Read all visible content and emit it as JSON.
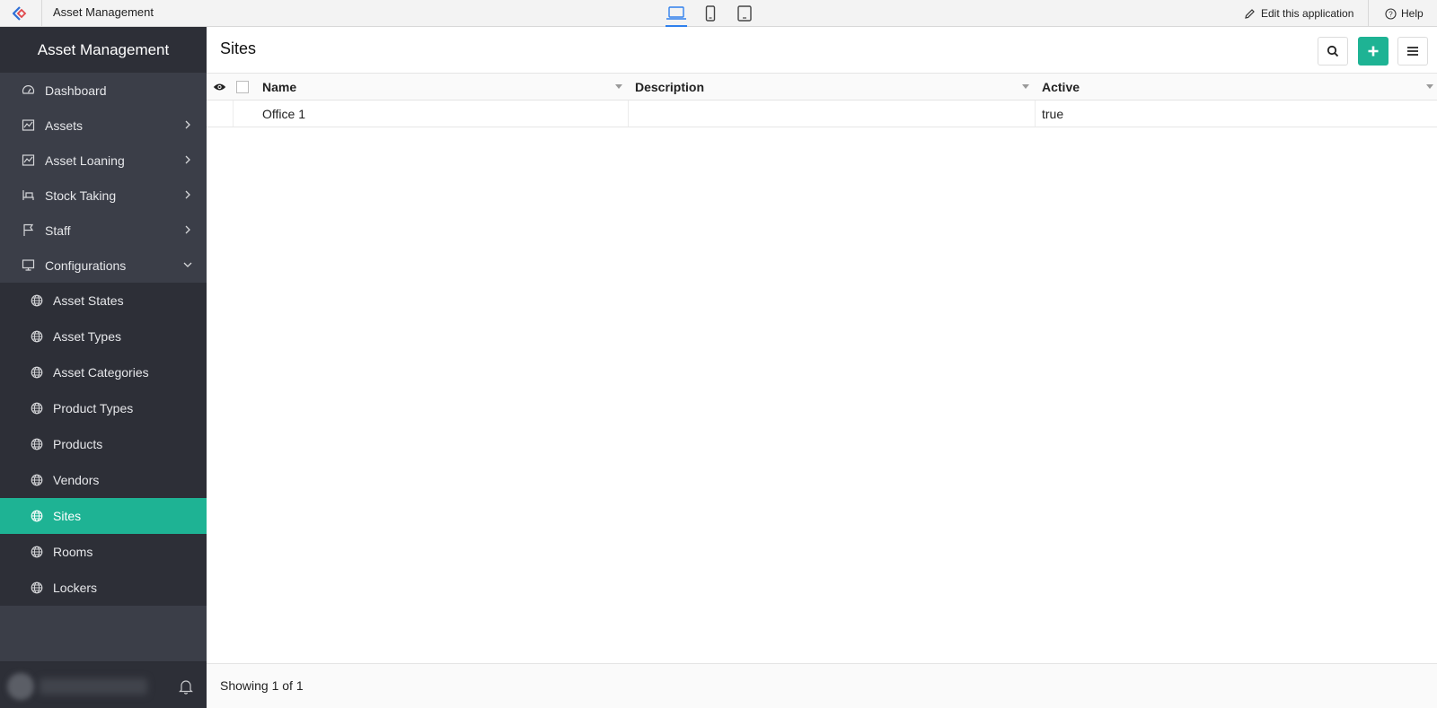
{
  "topbar": {
    "app_title": "Asset Management",
    "edit_label": "Edit this application",
    "help_label": "Help",
    "devices": [
      "laptop-icon",
      "phone-icon",
      "tablet-icon"
    ],
    "active_device": "laptop-icon"
  },
  "sidebar": {
    "header": "Asset Management",
    "items": [
      {
        "label": "Dashboard",
        "icon": "dashboard-icon",
        "expandable": false
      },
      {
        "label": "Assets",
        "icon": "chart-icon",
        "expandable": true
      },
      {
        "label": "Asset Loaning",
        "icon": "chart-icon",
        "expandable": true
      },
      {
        "label": "Stock Taking",
        "icon": "desk-icon",
        "expandable": true
      },
      {
        "label": "Staff",
        "icon": "flag-icon",
        "expandable": true
      },
      {
        "label": "Configurations",
        "icon": "monitor-icon",
        "expandable": true,
        "expanded": true
      }
    ],
    "sub_items": [
      {
        "label": "Asset States"
      },
      {
        "label": "Asset Types"
      },
      {
        "label": "Asset Categories"
      },
      {
        "label": "Product Types"
      },
      {
        "label": "Products"
      },
      {
        "label": "Vendors"
      },
      {
        "label": "Sites",
        "active": true
      },
      {
        "label": "Rooms"
      },
      {
        "label": "Lockers"
      }
    ]
  },
  "main": {
    "title": "Sites",
    "columns": [
      "Name",
      "Description",
      "Active"
    ],
    "rows": [
      {
        "name": "Office 1",
        "description": "",
        "active": "true"
      }
    ],
    "footer_text": "Showing 1 of 1"
  },
  "colors": {
    "accent": "#1eb394",
    "sidebar_bg": "#3b3e48",
    "sidebar_dark": "#2d2f37",
    "device_active": "#2f80ed"
  }
}
